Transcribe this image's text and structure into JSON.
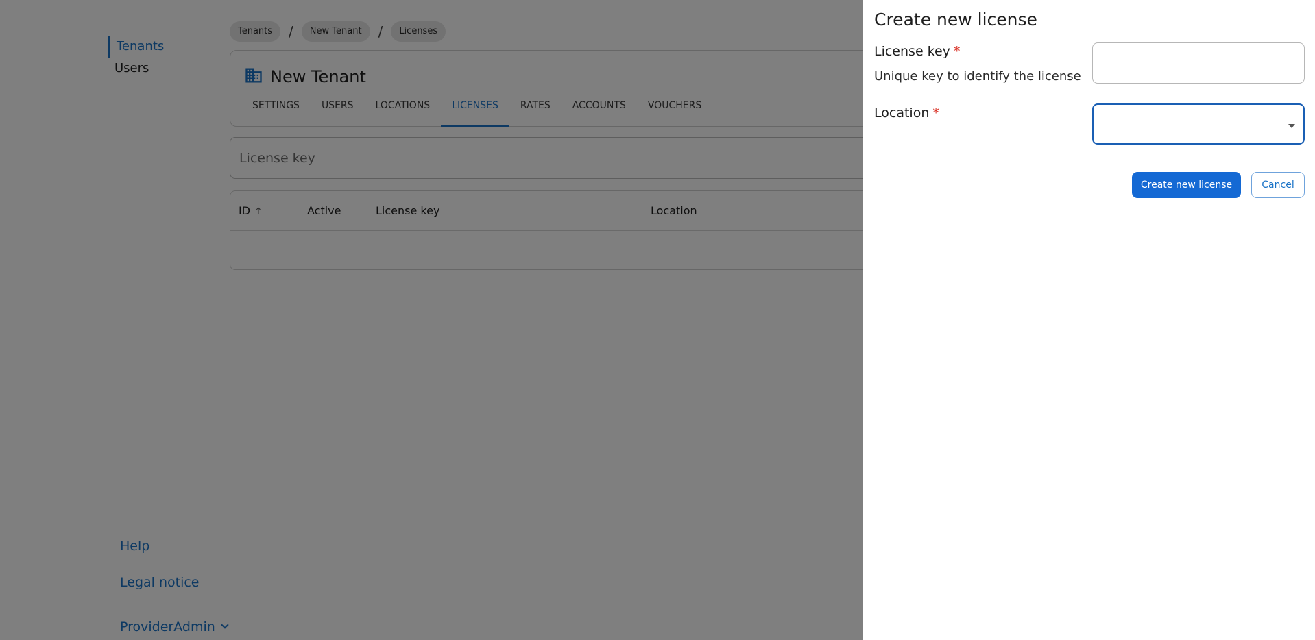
{
  "sidebar": {
    "nav": [
      {
        "label": "Tenants",
        "active": true
      },
      {
        "label": "Users",
        "active": false
      }
    ],
    "footer": {
      "help": "Help",
      "legal": "Legal notice",
      "user": "ProviderAdmin"
    }
  },
  "breadcrumb": [
    "Tenants",
    "New Tenant",
    "Licenses"
  ],
  "tenant": {
    "title": "New Tenant",
    "icon": "building-icon",
    "tabs": [
      {
        "label": "SETTINGS",
        "active": false
      },
      {
        "label": "USERS",
        "active": false
      },
      {
        "label": "LOCATIONS",
        "active": false
      },
      {
        "label": "LICENSES",
        "active": true
      },
      {
        "label": "RATES",
        "active": false
      },
      {
        "label": "ACCOUNTS",
        "active": false
      },
      {
        "label": "VOUCHERS",
        "active": false
      }
    ]
  },
  "filter": {
    "placeholder": "License key",
    "value": ""
  },
  "table": {
    "columns": [
      "ID",
      "Active",
      "License key",
      "Location"
    ],
    "sort_column": "ID",
    "sort_direction": "ascending",
    "rows": []
  },
  "drawer": {
    "title": "Create new license",
    "license_key": {
      "label": "License key",
      "required_mark": "*",
      "hint": "Unique key to identify the license",
      "value": ""
    },
    "location": {
      "label": "Location",
      "required_mark": "*",
      "value": ""
    },
    "submit_label": "Create new license",
    "cancel_label": "Cancel"
  },
  "colors": {
    "accent": "#1a73c7",
    "primary_button": "#1469d4",
    "required": "#d93025",
    "overlay": "rgba(0,0,0,0.5)"
  }
}
